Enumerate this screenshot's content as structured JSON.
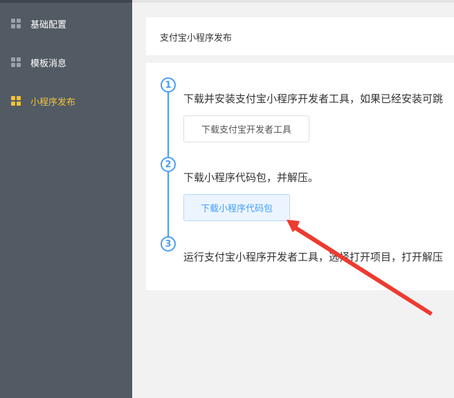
{
  "sidebar": {
    "items": [
      {
        "label": "基础配置",
        "icon": "grid-icon"
      },
      {
        "label": "模板消息",
        "icon": "grid-icon"
      },
      {
        "label": "小程序发布",
        "icon": "grid-icon",
        "active": true
      }
    ]
  },
  "page": {
    "title": "支付宝小程序发布"
  },
  "steps": [
    {
      "number": "1",
      "text": "下载并安装支付宝小程序开发者工具，如果已经安装可跳",
      "button": "下载支付宝开发者工具"
    },
    {
      "number": "2",
      "text": "下载小程序代码包，并解压。",
      "button": "下载小程序代码包"
    },
    {
      "number": "3",
      "text": "运行支付宝小程序开发者工具，选择打开项目，打开解压"
    }
  ],
  "colors": {
    "sidebar_bg": "#525a63",
    "active": "#f4c23a",
    "accent": "#4a9ef0",
    "annotation": "#ee3a2f"
  }
}
